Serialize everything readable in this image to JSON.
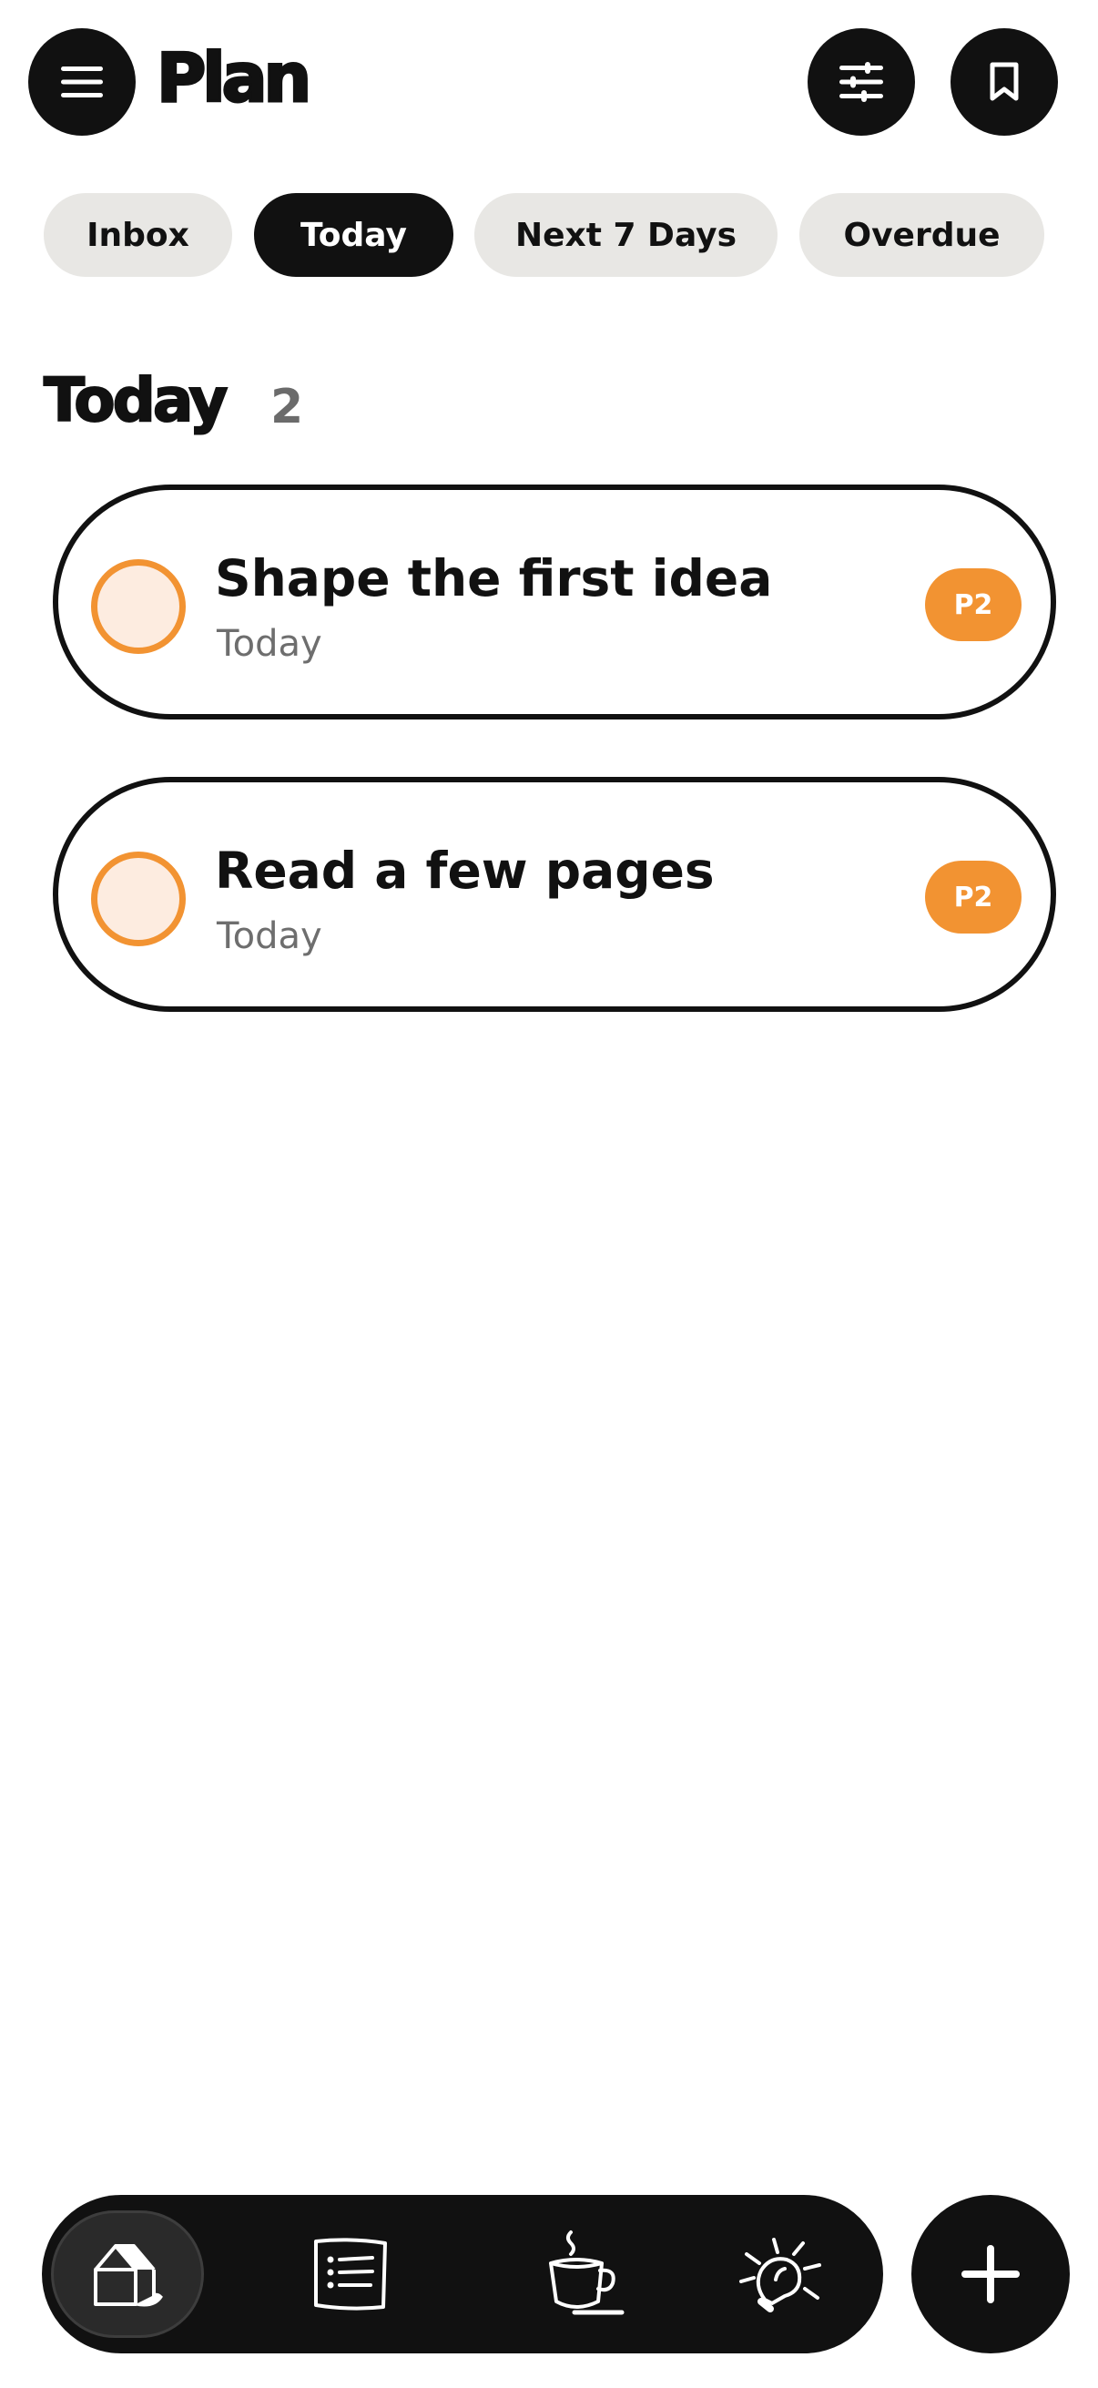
{
  "header": {
    "title": "Plan",
    "menu_icon": "hamburger-menu-icon",
    "filter_icon": "sliders-icon",
    "bookmark_icon": "bookmark-icon"
  },
  "tabs": [
    {
      "label": "Inbox",
      "active": false
    },
    {
      "label": "Today",
      "active": true
    },
    {
      "label": "Next 7 Days",
      "active": false
    },
    {
      "label": "Overdue",
      "active": false
    }
  ],
  "section": {
    "title": "Today",
    "count": "2"
  },
  "tasks": [
    {
      "title": "Shape the first idea",
      "due": "Today",
      "priority": "P2"
    },
    {
      "title": "Read a few pages",
      "due": "Today",
      "priority": "P2"
    }
  ],
  "bottom_nav": {
    "items": [
      {
        "icon": "house-icon",
        "active": true
      },
      {
        "icon": "notes-list-icon",
        "active": false
      },
      {
        "icon": "coffee-cup-icon",
        "active": false
      },
      {
        "icon": "lightbulb-icon",
        "active": false
      }
    ],
    "add_icon": "plus-icon"
  },
  "colors": {
    "accent": "#f29332",
    "accent_light": "#fdece0",
    "dark": "#111111",
    "tab_inactive": "#e8e7e4",
    "muted_text": "#6e6e6e"
  }
}
